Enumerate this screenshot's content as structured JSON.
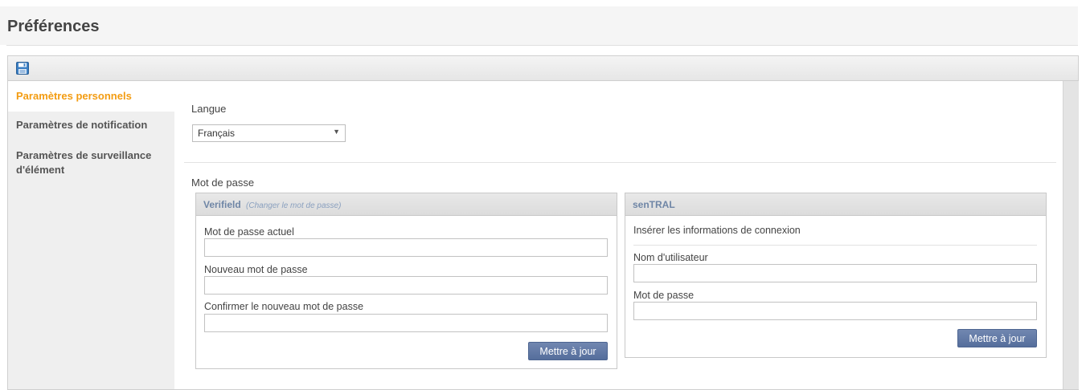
{
  "page": {
    "title": "Préférences"
  },
  "toolbar": {
    "save_icon": "save-icon"
  },
  "sidebar": {
    "items": [
      {
        "label": "Paramètres personnels",
        "active": true
      },
      {
        "label": "Paramètres de notification",
        "active": false
      },
      {
        "label": "Paramètres de surveillance d'élément",
        "active": false
      }
    ]
  },
  "language": {
    "label": "Langue",
    "selected": "Français"
  },
  "password_section": {
    "label": "Mot de passe"
  },
  "verifield": {
    "title": "Verifield",
    "subtitle": "(Changer le mot de passe)",
    "current_label": "Mot de passe actuel",
    "current_value": "",
    "new_label": "Nouveau mot de passe",
    "new_value": "",
    "confirm_label": "Confirmer le nouveau mot de passe",
    "confirm_value": "",
    "button": "Mettre à jour"
  },
  "sentral": {
    "title": "senTRAL",
    "info": "Insérer les informations de connexion",
    "username_label": "Nom d'utilisateur",
    "username_value": "",
    "password_label": "Mot de passe",
    "password_value": "",
    "button": "Mettre à jour"
  },
  "colors": {
    "accent": "#f39c12",
    "button": "#5b74a2",
    "box_title": "#6f86a6"
  }
}
